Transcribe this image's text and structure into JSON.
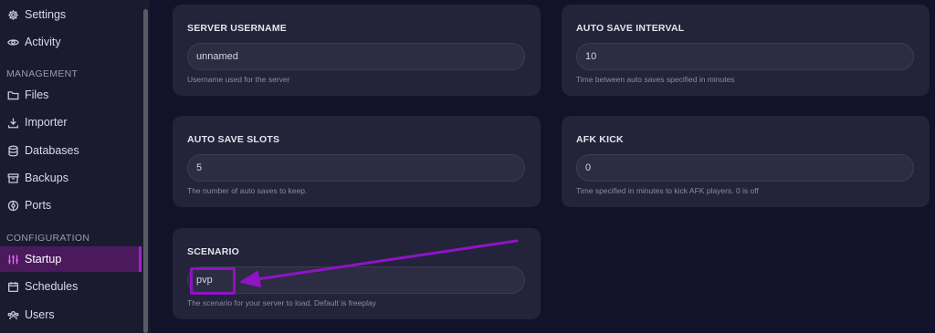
{
  "sidebar": {
    "items": [
      {
        "label": "Settings",
        "icon": "gear-icon"
      },
      {
        "label": "Activity",
        "icon": "eye-icon"
      },
      {
        "label": "Files",
        "icon": "folder-icon"
      },
      {
        "label": "Importer",
        "icon": "download-icon"
      },
      {
        "label": "Databases",
        "icon": "database-icon"
      },
      {
        "label": "Backups",
        "icon": "archive-icon"
      },
      {
        "label": "Ports",
        "icon": "network-icon"
      },
      {
        "label": "Startup",
        "icon": "sliders-icon",
        "active": true
      },
      {
        "label": "Schedules",
        "icon": "calendar-icon"
      },
      {
        "label": "Users",
        "icon": "users-icon"
      }
    ],
    "sections": {
      "management": "MANAGEMENT",
      "configuration": "CONFIGURATION"
    }
  },
  "variables": {
    "server_username": {
      "title": "SERVER USERNAME",
      "value": "unnamed",
      "hint": "Username used for the server"
    },
    "auto_save_interval": {
      "title": "AUTO SAVE INTERVAL",
      "value": "10",
      "hint": "Time between auto saves specified in minutes"
    },
    "auto_save_slots": {
      "title": "AUTO SAVE SLOTS",
      "value": "5",
      "hint": "The number of auto saves to keep."
    },
    "afk_kick": {
      "title": "AFK KICK",
      "value": "0",
      "hint": "Time specified in minutes to kick AFK players. 0 is off"
    },
    "scenario": {
      "title": "SCENARIO",
      "value": "pvp",
      "hint": "The scenario for your server to load. Default is freeplay"
    }
  },
  "colors": {
    "background": "#12122a",
    "sidebar": "#1b1b30",
    "card": "#23233a",
    "active_nav": "#4a1a5c",
    "annotation": "#8e14c4"
  }
}
